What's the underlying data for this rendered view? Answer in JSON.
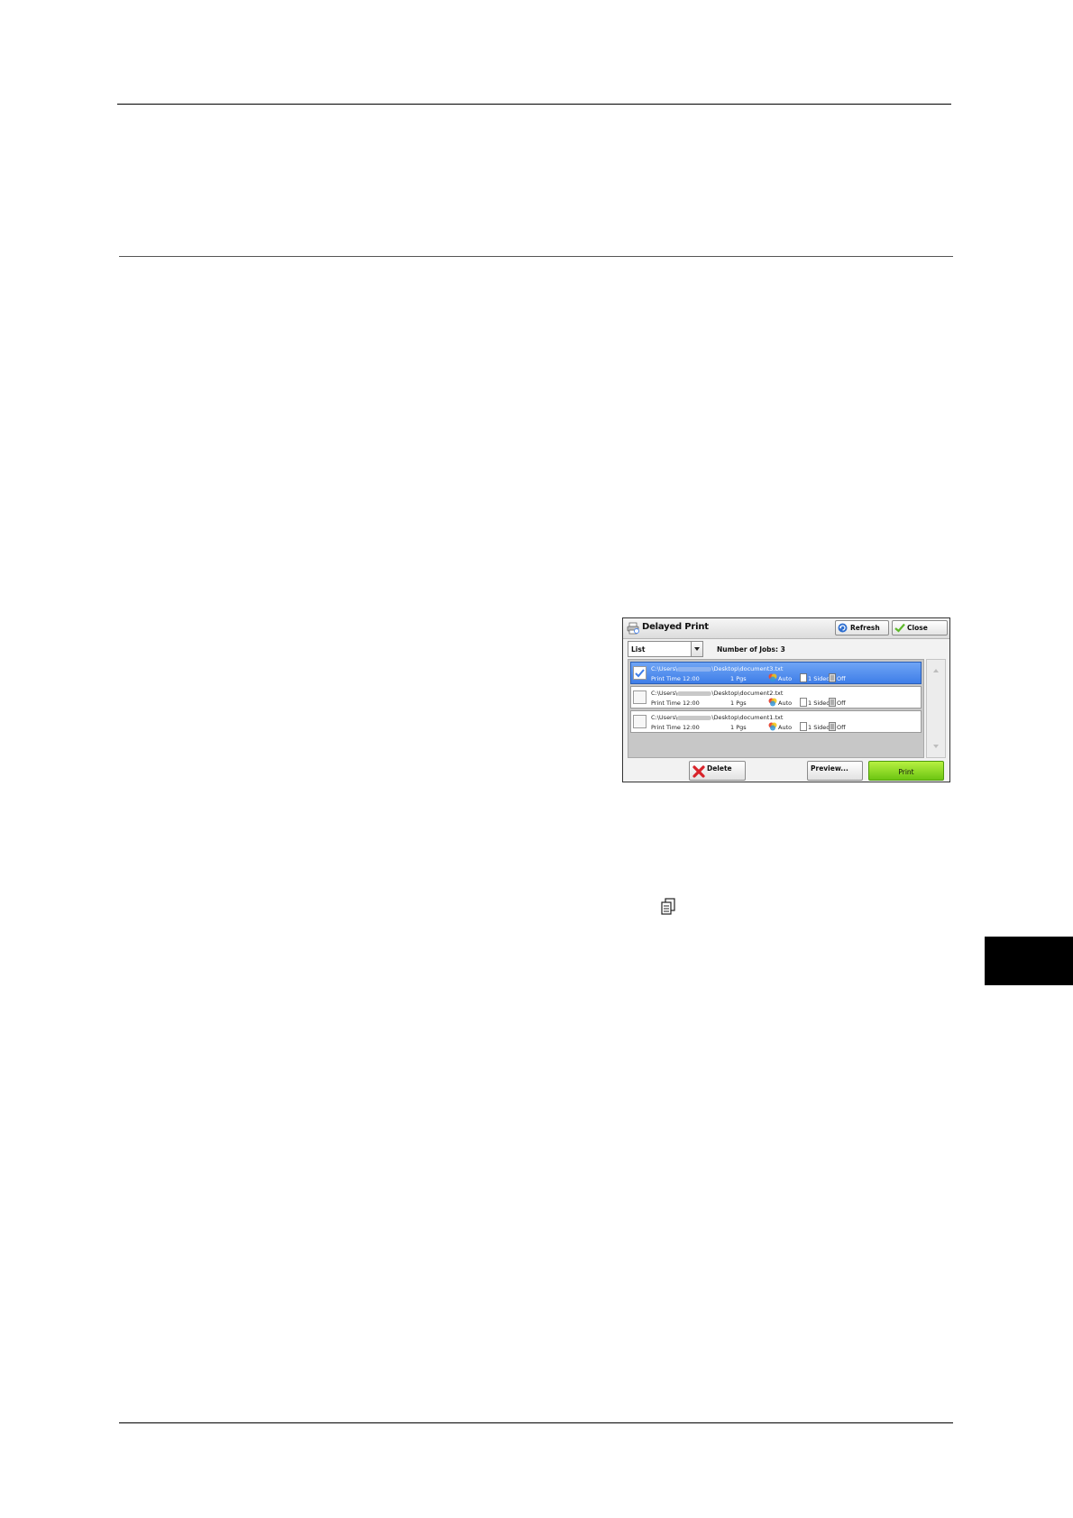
{
  "dialog": {
    "title": "Delayed Print",
    "refresh_label": "Refresh",
    "close_label": "Close",
    "view_select": "List",
    "jobs_count": "Number of Jobs: 3",
    "jobs": [
      {
        "path_prefix": "C:\\Users\\",
        "path_suffix": "\\Desktop\\document3.txt",
        "print_time": "Print Time 12:00",
        "pages": "1 Pgs",
        "color": "Auto",
        "sided": "1 Sided",
        "staple": "Off",
        "selected": true
      },
      {
        "path_prefix": "C:\\Users\\",
        "path_suffix": "\\Desktop\\document2.txt",
        "print_time": "Print Time 12:00",
        "pages": "1 Pgs",
        "color": "Auto",
        "sided": "1 Sided",
        "staple": "Off",
        "selected": false
      },
      {
        "path_prefix": "C:\\Users\\",
        "path_suffix": "\\Desktop\\document1.txt",
        "print_time": "Print Time 12:00",
        "pages": "1 Pgs",
        "color": "Auto",
        "sided": "1 Sided",
        "staple": "Off",
        "selected": false
      }
    ],
    "delete_label": "Delete",
    "preview_label": "Preview...",
    "print_label": "Print"
  },
  "colors": {
    "selected_row": "#4a86ee",
    "print_button": "#8bdc22",
    "delete_icon": "#d8232a"
  }
}
